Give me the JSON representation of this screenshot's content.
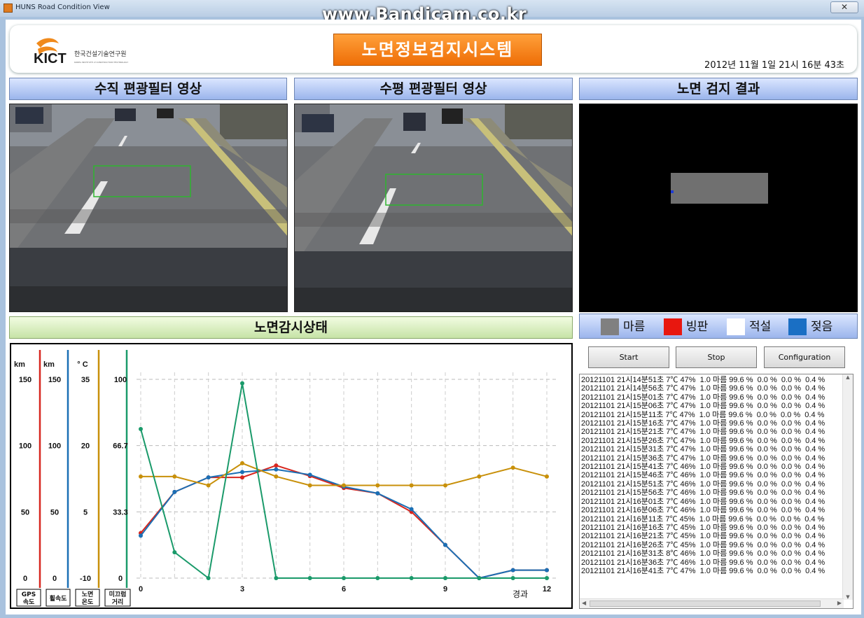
{
  "window": {
    "title": "HUNS Road Condition View",
    "close_label": "✕",
    "watermark": "www.Bandicam.co.kr"
  },
  "header": {
    "logo_text": "KICT",
    "logo_korean": "한국건설기술연구원",
    "logo_english": "KOREA INSTITUTE of CONSTRUCTION TECHNOLOGY",
    "system_title": "노면정보검지시스템",
    "datetime": "2012년 11월 1일 21시 16분 43초"
  },
  "panels": {
    "vertical_filter": "수직 편광필터 영상",
    "horizontal_filter": "수평 편광필터 영상",
    "detection_result": "노면 검지 결과",
    "monitoring": "노면감시상태"
  },
  "legend": [
    {
      "label": "마름",
      "color": "#808080"
    },
    {
      "label": "빙판",
      "color": "#e8170f"
    },
    {
      "label": "적설",
      "color": "#ffffff"
    },
    {
      "label": "젖음",
      "color": "#1a6fc4"
    }
  ],
  "buttons": {
    "start": "Start",
    "stop": "Stop",
    "configuration": "Configuration"
  },
  "log": [
    "20121101 21시14분51초 7℃ 47%  1.0 마름 99.6 %  0.0 %  0.0 %  0.4 %",
    "20121101 21시14분56초 7℃ 47%  1.0 마름 99.6 %  0.0 %  0.0 %  0.4 %",
    "20121101 21시15분01초 7℃ 47%  1.0 마름 99.6 %  0.0 %  0.0 %  0.4 %",
    "20121101 21시15분06초 7℃ 47%  1.0 마름 99.6 %  0.0 %  0.0 %  0.4 %",
    "20121101 21시15분11초 7℃ 47%  1.0 마름 99.6 %  0.0 %  0.0 %  0.4 %",
    "20121101 21시15분16초 7℃ 47%  1.0 마름 99.6 %  0.0 %  0.0 %  0.4 %",
    "20121101 21시15분21초 7℃ 47%  1.0 마름 99.6 %  0.0 %  0.0 %  0.4 %",
    "20121101 21시15분26초 7℃ 47%  1.0 마름 99.6 %  0.0 %  0.0 %  0.4 %",
    "20121101 21시15분31초 7℃ 47%  1.0 마름 99.6 %  0.0 %  0.0 %  0.4 %",
    "20121101 21시15분36초 7℃ 47%  1.0 마름 99.6 %  0.0 %  0.0 %  0.4 %",
    "20121101 21시15분41초 7℃ 46%  1.0 마름 99.6 %  0.0 %  0.0 %  0.4 %",
    "20121101 21시15분46초 7℃ 46%  1.0 마름 99.6 %  0.0 %  0.0 %  0.4 %",
    "20121101 21시15분51초 7℃ 46%  1.0 마름 99.6 %  0.0 %  0.0 %  0.4 %",
    "20121101 21시15분56초 7℃ 46%  1.0 마름 99.6 %  0.0 %  0.0 %  0.4 %",
    "20121101 21시16분01초 7℃ 46%  1.0 마름 99.6 %  0.0 %  0.0 %  0.4 %",
    "20121101 21시16분06초 7℃ 46%  1.0 마름 99.6 %  0.0 %  0.0 %  0.4 %",
    "20121101 21시16분11초 7℃ 45%  1.0 마름 99.6 %  0.0 %  0.0 %  0.4 %",
    "20121101 21시16분16초 7℃ 45%  1.0 마름 99.6 %  0.0 %  0.0 %  0.4 %",
    "20121101 21시16분21초 7℃ 45%  1.0 마름 99.6 %  0.0 %  0.0 %  0.4 %",
    "20121101 21시16분26초 7℃ 45%  1.0 마름 99.6 %  0.0 %  0.0 %  0.4 %",
    "20121101 21시16분31초 8℃ 46%  1.0 마름 99.6 %  0.0 %  0.0 %  0.4 %",
    "20121101 21시16분36초 7℃ 46%  1.0 마름 99.6 %  0.0 %  0.0 %  0.4 %",
    "20121101 21시16분41초 7℃ 47%  1.0 마름 99.6 %  0.0 %  0.0 %  0.4 %"
  ],
  "chart_data": {
    "type": "line",
    "xlabel": "경과",
    "x_ticks": [
      "0",
      "3",
      "6",
      "9",
      "12"
    ],
    "x": [
      0,
      1,
      2,
      3,
      4,
      5,
      6,
      7,
      8,
      9,
      10,
      11,
      12
    ],
    "axes": [
      {
        "unit": "km",
        "ticks": [
          "150",
          "100",
          "50",
          "0"
        ],
        "range": [
          0,
          150
        ],
        "color": "#d7261e",
        "button": "GPS\n속도"
      },
      {
        "unit": "km",
        "ticks": [
          "150",
          "100",
          "50",
          "0"
        ],
        "range": [
          0,
          150
        ],
        "color": "#1a6fb5",
        "button": "휠속도"
      },
      {
        "unit": "° C",
        "ticks": [
          "35",
          "20",
          "5",
          "-10"
        ],
        "range": [
          -10,
          35
        ],
        "color": "#c8900a",
        "button": "노면\n온도"
      },
      {
        "unit": "",
        "ticks": [
          "100",
          "66.7",
          "33.3",
          "0"
        ],
        "range": [
          0,
          100
        ],
        "color": "#1a9a6a",
        "button": "미끄럼\n거리"
      }
    ],
    "series": [
      {
        "values": [
          34,
          65,
          76,
          76,
          85,
          77,
          68,
          64,
          50,
          25,
          0,
          6,
          6
        ],
        "color": "#d7261e",
        "axis": 0
      },
      {
        "values": [
          32,
          65,
          76,
          80,
          82,
          78,
          69,
          64,
          52,
          25,
          0,
          6,
          6
        ],
        "color": "#1a6fb5",
        "axis": 1
      },
      {
        "values": [
          23,
          23,
          21,
          26,
          23,
          21,
          21,
          21,
          21,
          21,
          23,
          25,
          23
        ],
        "color": "#c8900a",
        "axis": 2
      },
      {
        "values": [
          75,
          13,
          0,
          98,
          0,
          0,
          0,
          0,
          0,
          0,
          0,
          0,
          0
        ],
        "color": "#1a9a6a",
        "axis": 3
      }
    ],
    "ylim": [
      0,
      150
    ],
    "grid": true
  },
  "detection": {
    "marker_color": "#1f3bd6",
    "patch_color": "#707070"
  }
}
